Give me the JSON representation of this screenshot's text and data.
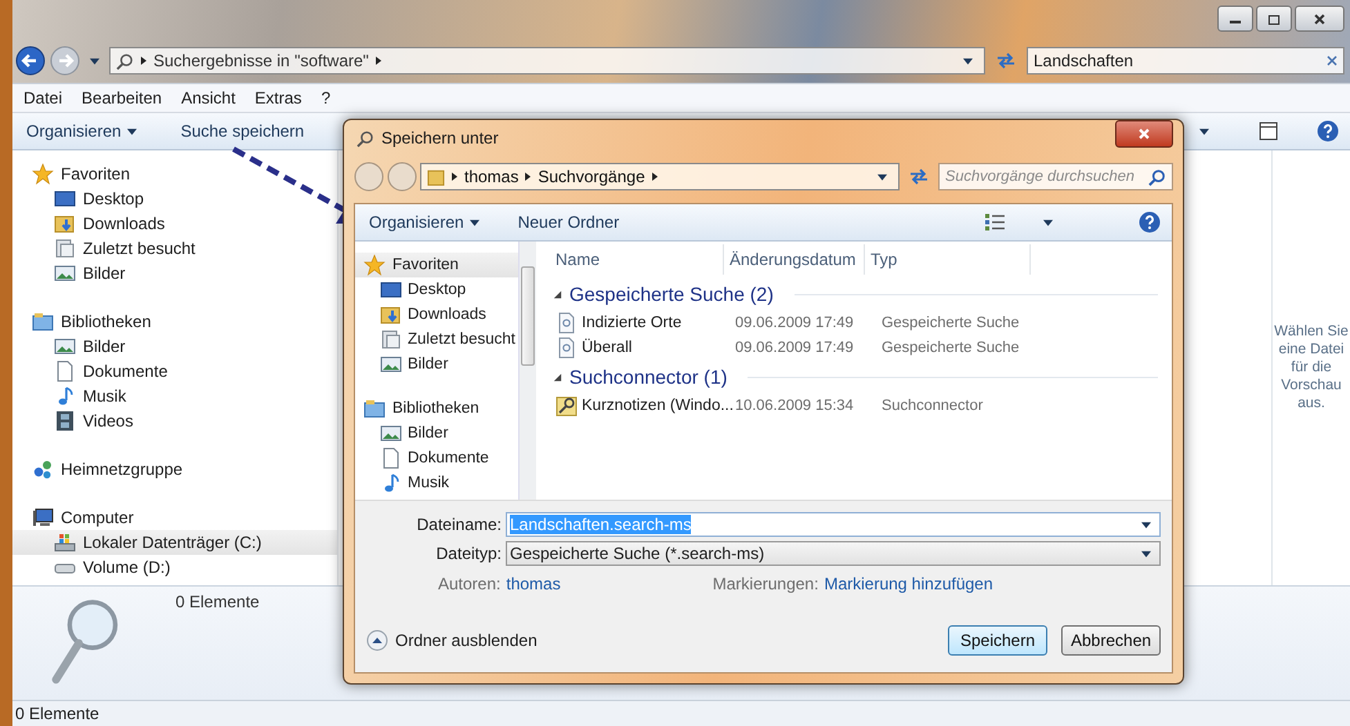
{
  "explorer": {
    "address": {
      "breadcrumb": [
        "Suchergebnisse in \"software\""
      ]
    },
    "search": {
      "value": "Landschaften"
    },
    "menu": [
      "Datei",
      "Bearbeiten",
      "Ansicht",
      "Extras",
      "?"
    ],
    "toolbar": [
      {
        "label": "Organisieren",
        "dropdown": true
      },
      {
        "label": "Suche speichern",
        "dropdown": false
      }
    ],
    "navigation": [
      {
        "label": "Favoriten",
        "kind": "star",
        "selected": false,
        "children": [
          {
            "label": "Desktop",
            "kind": "desktop",
            "selected": false
          },
          {
            "label": "Downloads",
            "kind": "downloads",
            "selected": false
          },
          {
            "label": "Zuletzt besucht",
            "kind": "recent",
            "selected": false
          },
          {
            "label": "Bilder",
            "kind": "pictures",
            "selected": false
          }
        ]
      },
      {
        "label": "Bibliotheken",
        "kind": "library",
        "selected": false,
        "children": [
          {
            "label": "Bilder",
            "kind": "pictures",
            "selected": false
          },
          {
            "label": "Dokumente",
            "kind": "documents",
            "selected": false
          },
          {
            "label": "Musik",
            "kind": "music",
            "selected": false
          },
          {
            "label": "Videos",
            "kind": "videos",
            "selected": false
          }
        ]
      },
      {
        "label": "Heimnetzgruppe",
        "kind": "network",
        "selected": false
      },
      {
        "label": "Computer",
        "kind": "computer",
        "selected": false,
        "children": [
          {
            "label": "Lokaler Datenträger (C:)",
            "kind": "drive",
            "selected": true
          },
          {
            "label": "Volume (D:)",
            "kind": "volume",
            "selected": false
          }
        ]
      }
    ],
    "details": {
      "count": "0 Elemente"
    },
    "preview": {
      "message": "Wählen Sie eine Datei für die Vorschau aus."
    },
    "status_bar": "0 Elemente"
  },
  "dialog": {
    "title": "Speichern unter",
    "breadcrumb": [
      "thomas",
      "Suchvorgänge"
    ],
    "search": {
      "placeholder": "Suchvorgänge durchsuchen"
    },
    "toolbar": [
      {
        "label": "Organisieren",
        "dropdown": true
      },
      {
        "label": "Neuer Ordner",
        "dropdown": false
      }
    ],
    "navigation": [
      {
        "label": "Favoriten",
        "kind": "star",
        "selected": true,
        "children": [
          {
            "label": "Desktop",
            "kind": "desktop",
            "selected": false
          },
          {
            "label": "Downloads",
            "kind": "downloads",
            "selected": false
          },
          {
            "label": "Zuletzt besucht",
            "kind": "recent",
            "selected": false
          },
          {
            "label": "Bilder",
            "kind": "pictures",
            "selected": false
          }
        ]
      },
      {
        "label": "Bibliotheken",
        "kind": "library",
        "selected": false,
        "children": [
          {
            "label": "Bilder",
            "kind": "pictures",
            "selected": false
          },
          {
            "label": "Dokumente",
            "kind": "documents",
            "selected": false
          },
          {
            "label": "Musik",
            "kind": "music",
            "selected": false
          }
        ]
      }
    ],
    "columns": [
      "Name",
      "Änderungsdatum",
      "Typ"
    ],
    "groups": [
      {
        "title": "Gespeicherte Suche (2)",
        "expanded": true,
        "rows": [
          {
            "name": "Indizierte Orte",
            "date": "09.06.2009 17:49",
            "type": "Gespeicherte Suche",
            "kind": "search"
          },
          {
            "name": "Überall",
            "date": "09.06.2009 17:49",
            "type": "Gespeicherte Suche",
            "kind": "search"
          }
        ]
      },
      {
        "title": "Suchconnector (1)",
        "expanded": true,
        "rows": [
          {
            "name": "Kurznotizen (Windo...",
            "date": "10.06.2009 15:34",
            "type": "Suchconnector",
            "kind": "connector"
          }
        ]
      }
    ],
    "filename": {
      "label": "Dateiname:",
      "value": "Landschaften.search-ms"
    },
    "filetype": {
      "label": "Dateityp:",
      "value": "Gespeicherte Suche (*.search-ms)"
    },
    "authors": {
      "label": "Autoren:",
      "value": "thomas"
    },
    "tags": {
      "label": "Markierungen:",
      "value": "Markierung hinzufügen"
    },
    "hide_folders": "Ordner ausblenden",
    "buttons": [
      {
        "label": "Speichern",
        "default": true
      },
      {
        "label": "Abbrechen",
        "default": false
      }
    ]
  }
}
